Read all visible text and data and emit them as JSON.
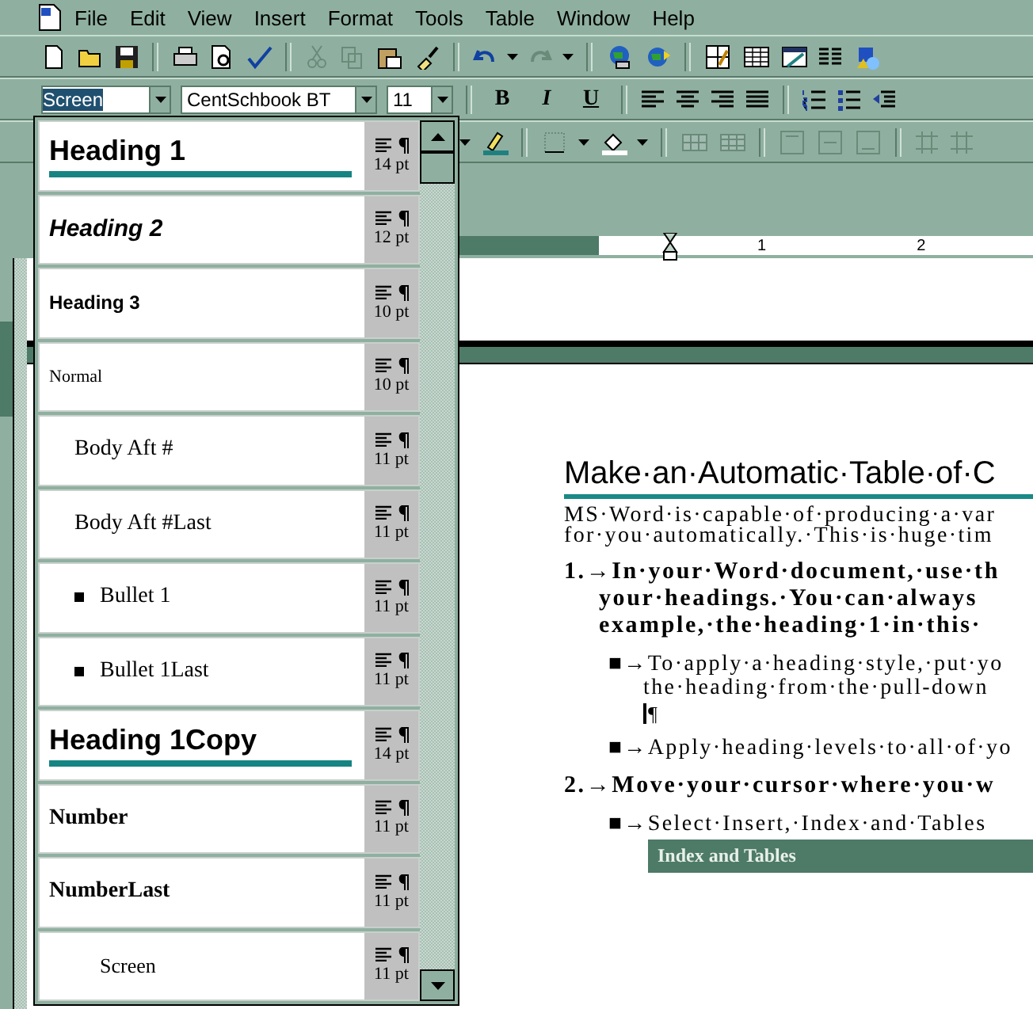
{
  "menu": [
    "File",
    "Edit",
    "View",
    "Insert",
    "Format",
    "Tools",
    "Table",
    "Window",
    "Help"
  ],
  "formatting": {
    "style_box": {
      "value": "Screen",
      "selected": true
    },
    "font_box": {
      "value": "CentSchbook BT"
    },
    "size_box": {
      "value": "11"
    },
    "bold": "B",
    "italic": "I",
    "underline": "U"
  },
  "style_list": [
    {
      "name": "Heading 1",
      "kind": "heading1",
      "size": "14 pt"
    },
    {
      "name": "Heading 2",
      "kind": "heading2",
      "size": "12 pt"
    },
    {
      "name": "Heading 3",
      "kind": "heading3",
      "size": "10 pt"
    },
    {
      "name": "Normal",
      "kind": "normal",
      "size": "10 pt"
    },
    {
      "name": "Body Aft #",
      "kind": "body",
      "size": "11 pt"
    },
    {
      "name": "Body Aft #Last",
      "kind": "body",
      "size": "11 pt"
    },
    {
      "name": "Bullet 1",
      "kind": "bullet",
      "size": "11 pt"
    },
    {
      "name": "Bullet 1Last",
      "kind": "bullet",
      "size": "11 pt"
    },
    {
      "name": "Heading 1Copy",
      "kind": "heading1",
      "size": "14 pt"
    },
    {
      "name": "Number",
      "kind": "number",
      "size": "11 pt"
    },
    {
      "name": "NumberLast",
      "kind": "number",
      "size": "11 pt"
    },
    {
      "name": "Screen",
      "kind": "screen",
      "size": "11 pt"
    }
  ],
  "ruler": [
    "1",
    "2"
  ],
  "document": {
    "title": "Make·an·Automatic·Table·of·C",
    "paragraphs": [
      {
        "kind": "body",
        "lines": [
          "MS·Word·is·capable·of·producing·a·var",
          "for·you·automatically.·This·is·huge·tim"
        ]
      },
      {
        "kind": "step",
        "lines": [
          "1.→In·your·Word·document,·use·th",
          "your·headings.·You·can·always",
          "example,·the·heading·1·in·this·"
        ]
      },
      {
        "kind": "bullet",
        "lines": [
          "■→To·apply·a·heading·style,·put·yo",
          "the·heading·from·the·pull-down"
        ]
      },
      {
        "kind": "mark",
        "lines": [
          "¶"
        ]
      },
      {
        "kind": "bullet",
        "lines": [
          "■→Apply·heading·levels·to·all·of·yo"
        ]
      },
      {
        "kind": "step",
        "lines": [
          "2.→Move·your·cursor·where·you·w"
        ]
      },
      {
        "kind": "bullet",
        "lines": [
          "■→Select·Insert,·Index·and·Tables"
        ]
      }
    ],
    "dialog_title": "Index and Tables"
  }
}
